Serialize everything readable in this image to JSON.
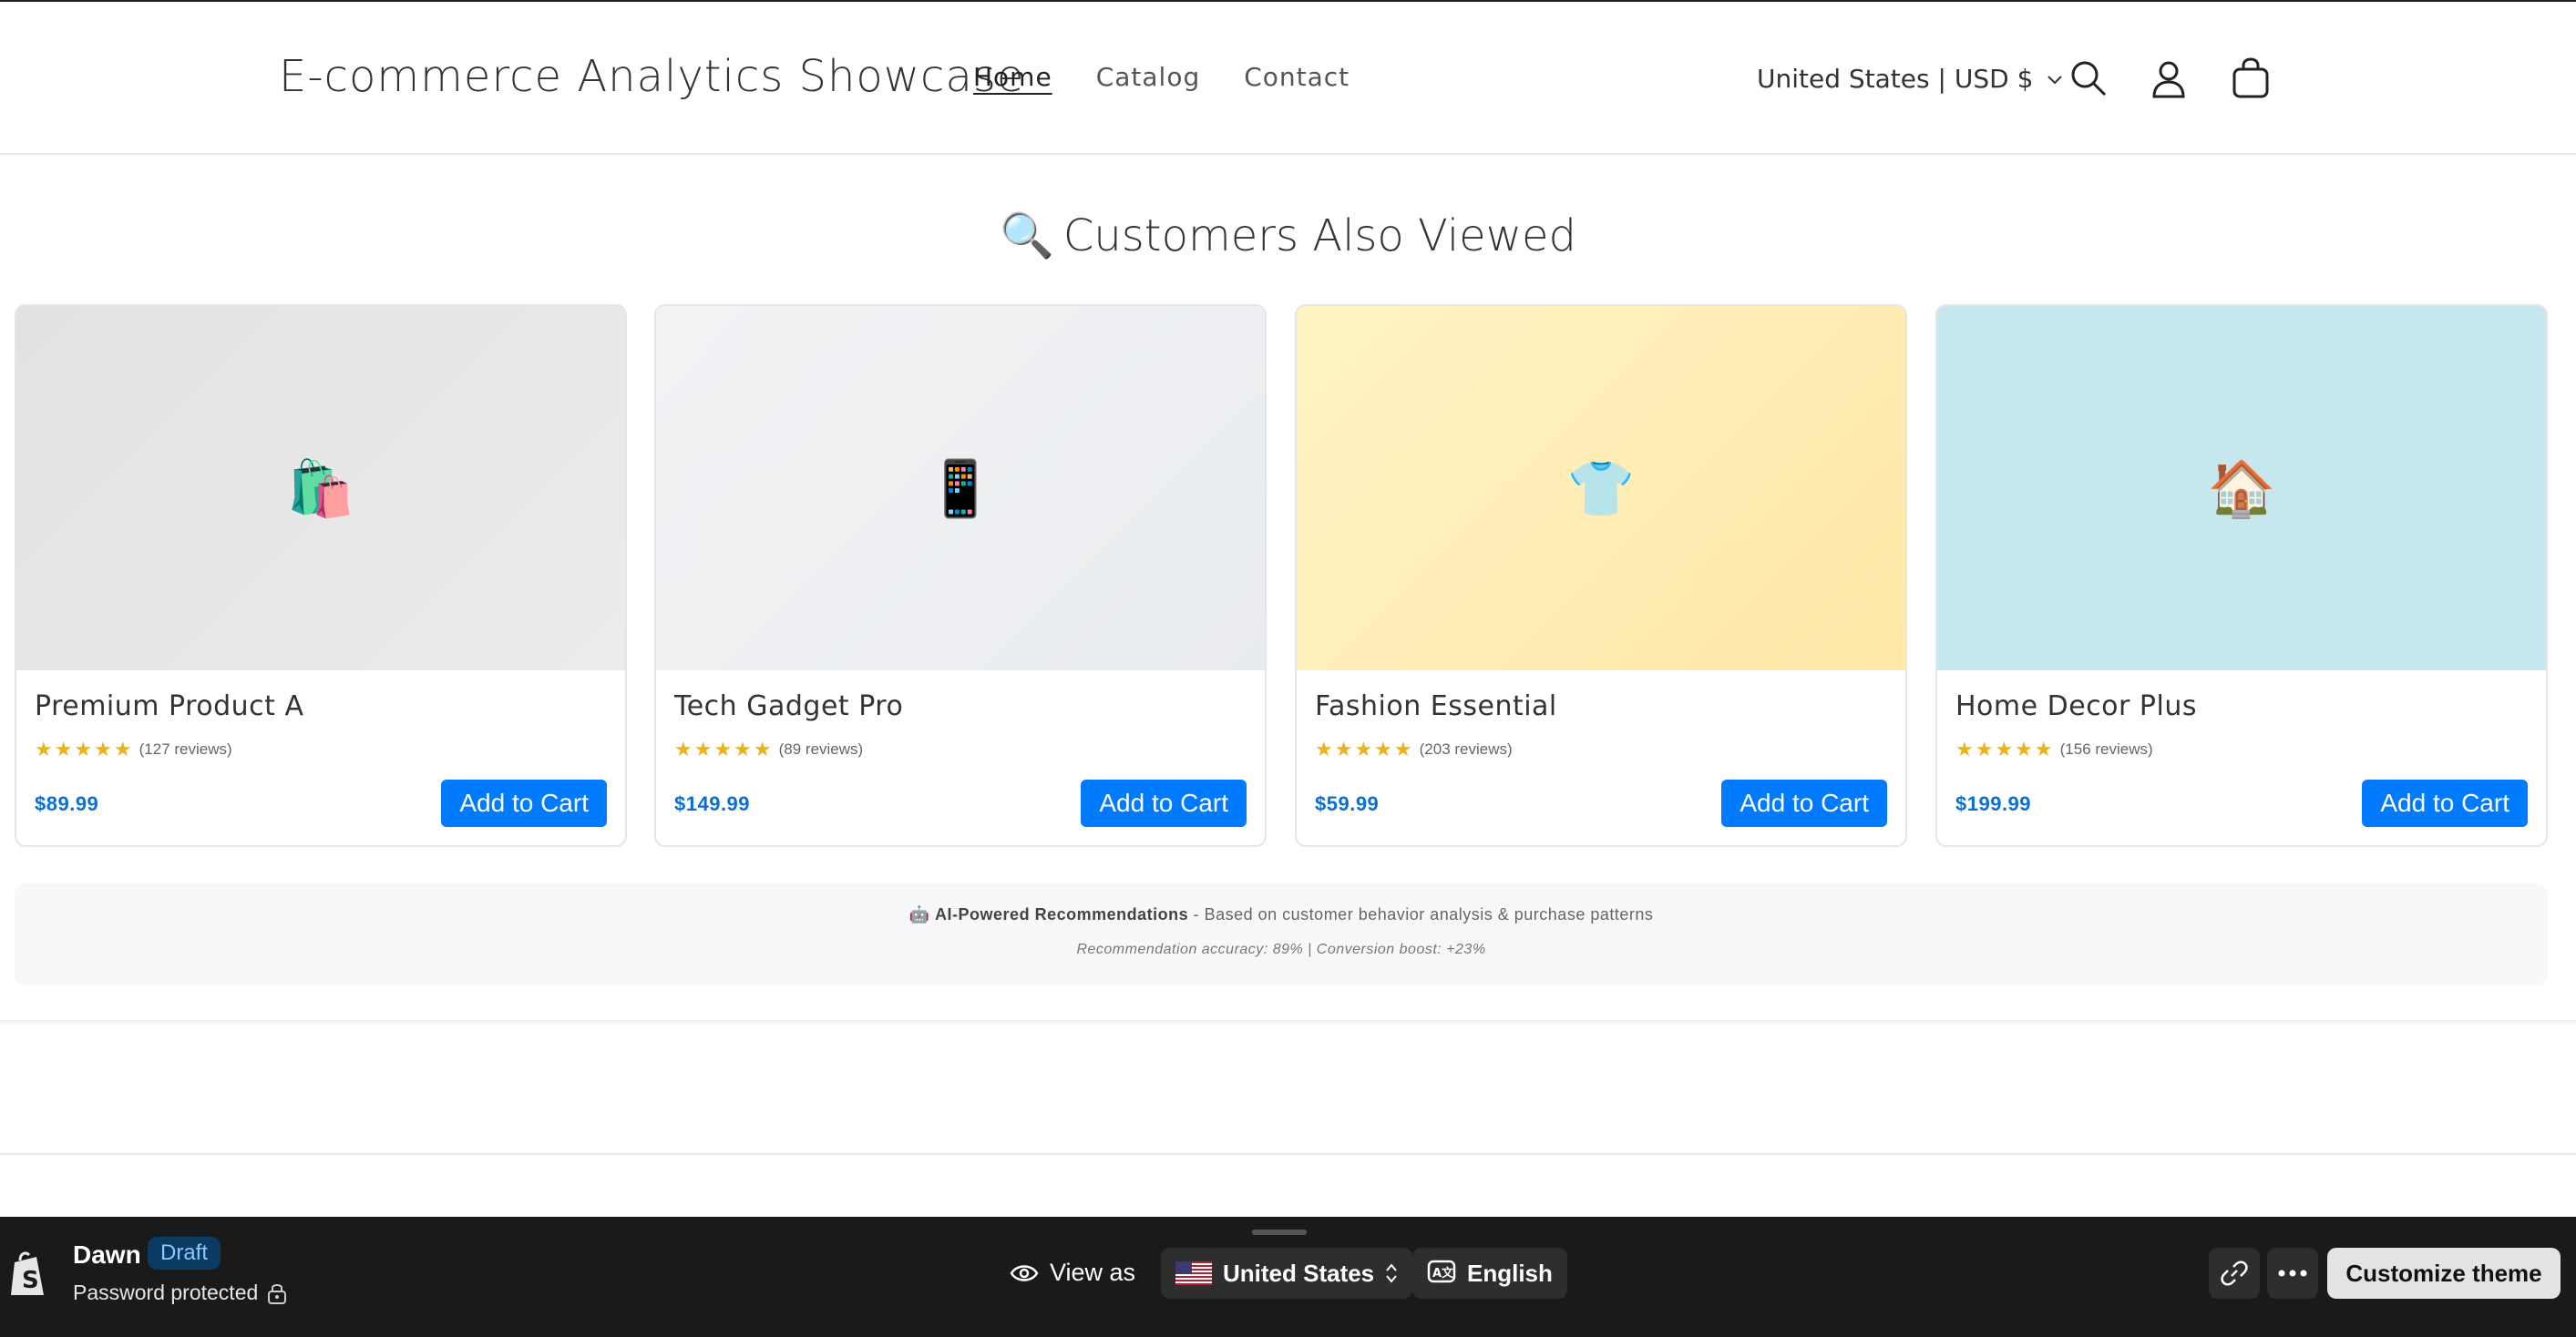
{
  "header": {
    "brand": "E-commerce Analytics Showcase",
    "nav": [
      "Home",
      "Catalog",
      "Contact"
    ],
    "locale": "United States | USD $",
    "icons": [
      "search-icon",
      "account-icon",
      "cart-icon"
    ]
  },
  "section": {
    "emoji": "🔍",
    "title": "Customers Also Viewed"
  },
  "products": [
    {
      "name": "Premium Product A",
      "reviews": "(127 reviews)",
      "price": "$89.99",
      "button": "Add to Cart",
      "emoji": "🛍️",
      "stars": "★★★★★",
      "bg": "linear-gradient(135deg,#e2e2e2,#ececec)"
    },
    {
      "name": "Tech Gadget Pro",
      "reviews": "(89 reviews)",
      "price": "$149.99",
      "button": "Add to Cart",
      "emoji": "📱",
      "stars": "★★★★★",
      "bg": "linear-gradient(135deg,#f1f2f4,#e9ecef)"
    },
    {
      "name": "Fashion Essential",
      "reviews": "(203 reviews)",
      "price": "$59.99",
      "button": "Add to Cart",
      "emoji": "👕",
      "stars": "★★★★★",
      "bg": "linear-gradient(135deg,#fff3c4,#ffe8a8)"
    },
    {
      "name": "Home Decor Plus",
      "reviews": "(156 reviews)",
      "price": "$199.99",
      "button": "Add to Cart",
      "emoji": "🏠",
      "stars": "★★★★★",
      "bg": "#c6e7ee"
    }
  ],
  "ai": {
    "emoji": "🤖",
    "title": "AI-Powered Recommendations",
    "subtitle": " - Based on customer behavior analysis & purchase patterns",
    "stats": "Recommendation accuracy: 89% | Conversion boost: +23%"
  },
  "bottom_bar": {
    "theme": "Dawn",
    "badge": "Draft",
    "password": "Password protected",
    "view_as": "View as",
    "country": "United States",
    "language": "English",
    "customize": "Customize theme"
  },
  "colors": {
    "accent": "#007bff",
    "price": "#0a6fd6",
    "star": "#e8b321",
    "bar_bg": "#1a1a1a"
  }
}
